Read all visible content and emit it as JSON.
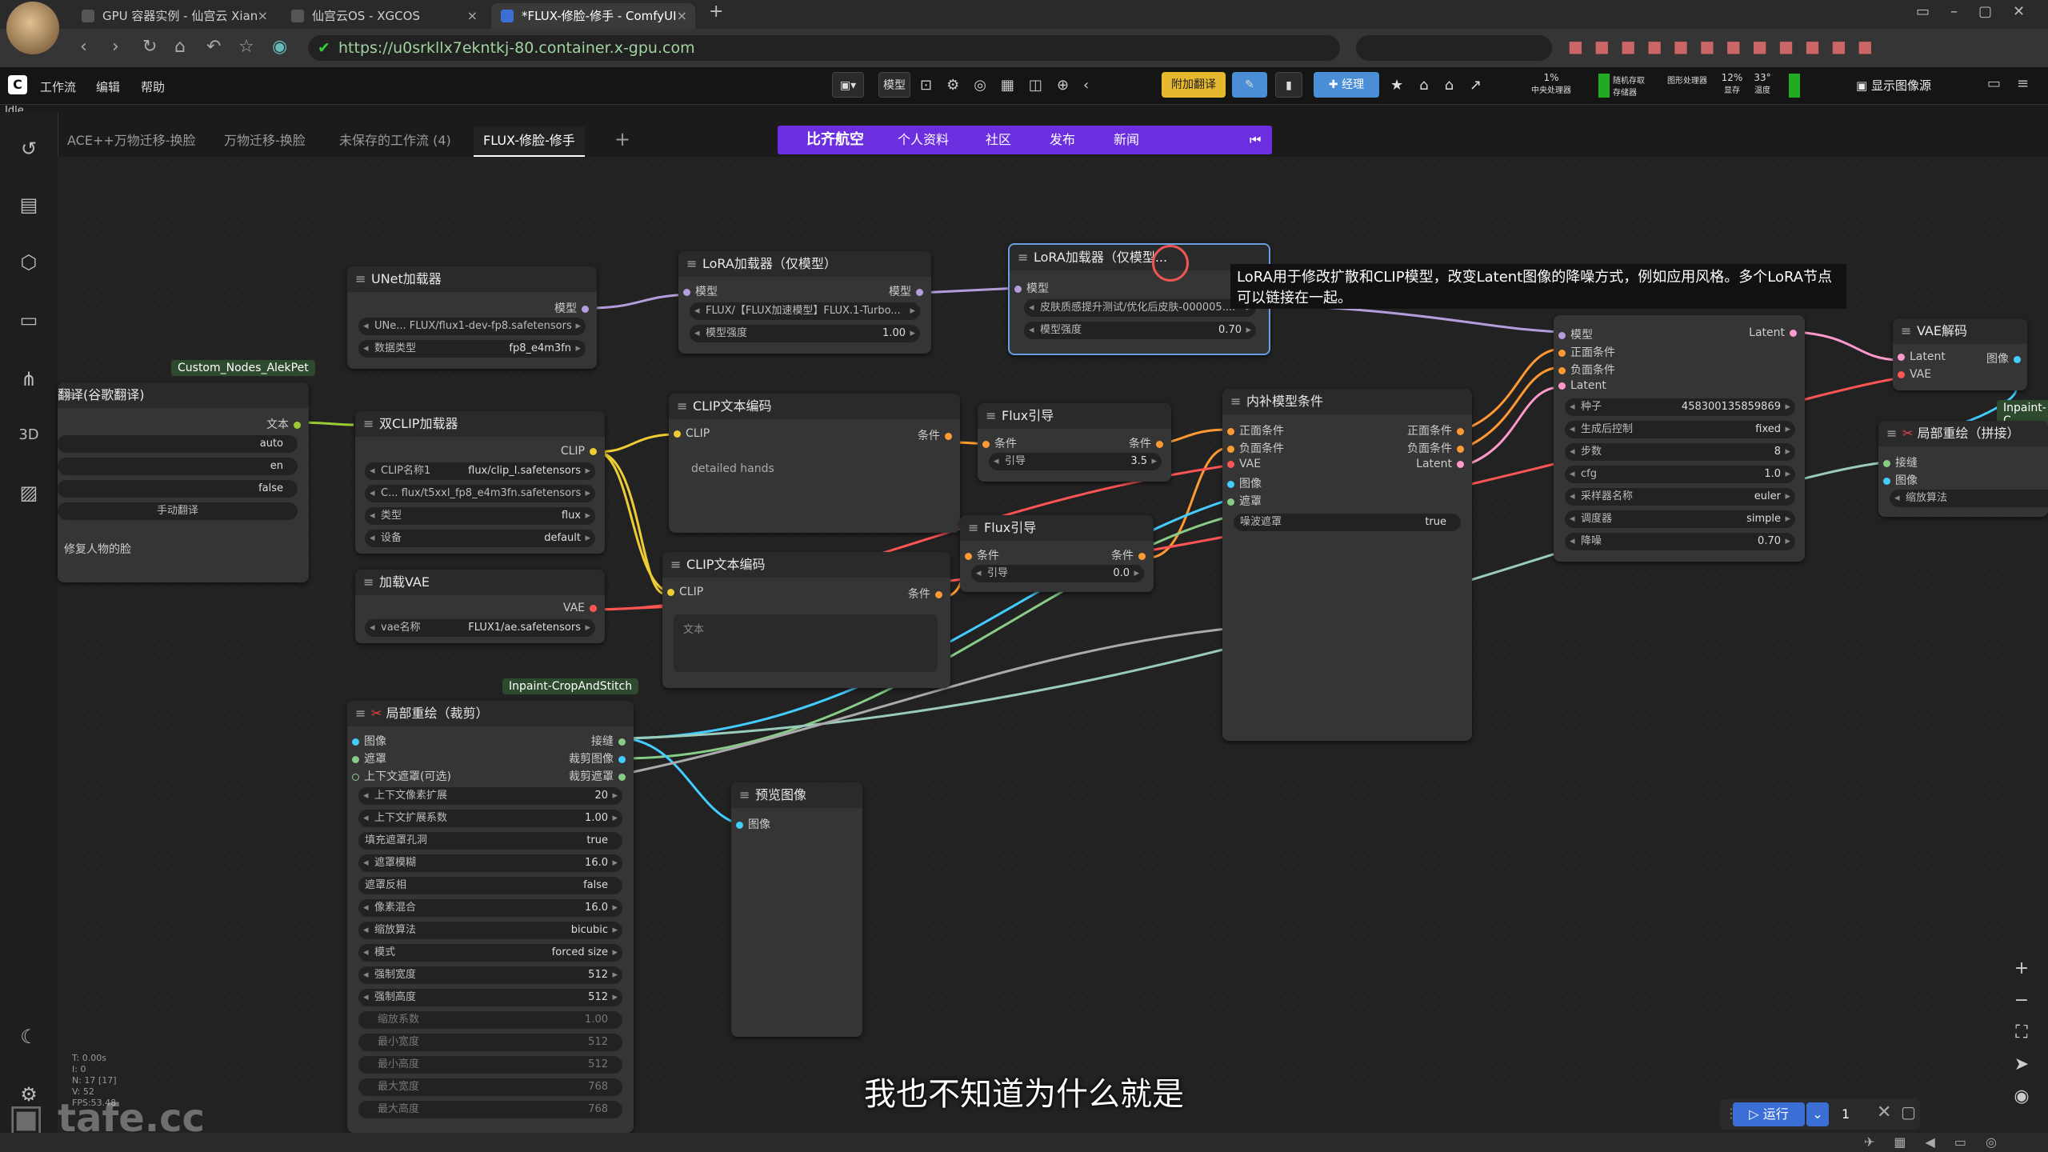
{
  "browser": {
    "tabs": [
      {
        "label": "GPU 容器实例 - 仙宫云 Xian"
      },
      {
        "label": "仙宫云OS - XGCOS"
      },
      {
        "label": "*FLUX-修脸-修手 - ComfyUI"
      }
    ],
    "url": "https://u0srkllx7ekntkj-80.container.x-gpu.com"
  },
  "menu": {
    "items": [
      "工作流",
      "编辑",
      "帮助"
    ],
    "status": "Idle",
    "model_btn": "模型",
    "translate_btn": "附加翻译",
    "manager_btn": "经理",
    "cpu": "1%",
    "cpu_label": "中央处理器",
    "mem_label": "随机存取存储器",
    "gpu_label": "图形处理器",
    "vram": "12%",
    "vram_label": "显存",
    "temp": "33°",
    "temp_label": "温度",
    "show_image": "显示图像源"
  },
  "workflow_tabs": [
    "ACE++万物迁移-换脸",
    "万物迁移-换脸",
    "未保存的工作流 (4)",
    "FLUX-修脸-修手"
  ],
  "banner": {
    "brand": "比齐航空",
    "items": [
      "个人资料",
      "社区",
      "发布",
      "新闻"
    ]
  },
  "nodes": {
    "unet": {
      "title": "UNet加载器",
      "out": "模型",
      "w1_label": "UNe... FLUX/flux1-dev-fp8.safetensors",
      "w2_label": "数据类型",
      "w2_value": "fp8_e4m3fn"
    },
    "lora1": {
      "title": "LoRA加载器（仅模型）",
      "in": "模型",
      "out": "模型",
      "w1": "FLUX/【FLUX加速模型】FLUX.1-Turbo...",
      "w2_label": "模型强度",
      "w2_value": "1.00"
    },
    "lora2": {
      "title": "LoRA加载器（仅模型...",
      "in": "模型",
      "w1": "皮肤质感提升测试/优化后皮肤-000005....",
      "w2_label": "模型强度",
      "w2_value": "0.70"
    },
    "translate": {
      "tag": "Custom_Nodes_AlekPet",
      "title": "翻译(谷歌翻译)",
      "out": "文本",
      "w1_value": "auto",
      "w2_value": "en",
      "w3_value": "false",
      "btn": "手动翻译",
      "text": "修复人物的脸"
    },
    "dualclip": {
      "title": "双CLIP加载器",
      "out": "CLIP",
      "w1_label": "CLIP名称1",
      "w1_value": "flux/clip_l.safetensors",
      "w2_label": "C... flux/t5xxl_fp8_e4m3fn.safetensors",
      "w3_label": "类型",
      "w3_value": "flux",
      "w4_label": "设备",
      "w4_value": "default"
    },
    "vae": {
      "title": "加载VAE",
      "out": "VAE",
      "w1_label": "vae名称",
      "w1_value": "FLUX1/ae.safetensors"
    },
    "clip1": {
      "title": "CLIP文本编码",
      "in": "CLIP",
      "out": "条件",
      "text": "detailed hands"
    },
    "clip2": {
      "title": "CLIP文本编码",
      "in": "CLIP",
      "out": "条件",
      "text": "文本"
    },
    "flux1": {
      "title": "Flux引导",
      "in": "条件",
      "out": "条件",
      "w_label": "引导",
      "w_value": "3.5"
    },
    "flux2": {
      "title": "Flux引导",
      "in": "条件",
      "out": "条件",
      "w_label": "引导",
      "w_value": "0.0"
    },
    "inpaint": {
      "title": "内补模型条件",
      "ins": [
        "正面条件",
        "负面条件",
        "VAE",
        "图像",
        "遮罩"
      ],
      "outs": [
        "正面条件",
        "负面条件",
        "Latent"
      ],
      "w_label": "噪波遮罩",
      "w_value": "true"
    },
    "ksampler": {
      "ins": [
        "模型",
        "正面条件",
        "负面条件",
        "Latent"
      ],
      "out": "Latent",
      "widgets": [
        [
          "种子",
          "458300135859869"
        ],
        [
          "生成后控制",
          "fixed"
        ],
        [
          "步数",
          "8"
        ],
        [
          "cfg",
          "1.0"
        ],
        [
          "采样器名称",
          "euler"
        ],
        [
          "调度器",
          "simple"
        ],
        [
          "降噪",
          "0.70"
        ]
      ]
    },
    "vaedecode": {
      "title": "VAE解码",
      "ins": [
        "Latent",
        "VAE"
      ],
      "out": "图像"
    },
    "stitch": {
      "tag": "Inpaint-C",
      "title": "局部重绘（拼接）",
      "ins": [
        "接缝",
        "图像"
      ],
      "w_label": "缩放算法"
    },
    "crop": {
      "tag": "Inpaint-CropAndStitch",
      "title": "局部重绘（裁剪）",
      "ins": [
        "图像",
        "遮罩",
        "上下文遮罩(可选)"
      ],
      "outs": [
        "接缝",
        "裁剪图像",
        "裁剪遮罩"
      ],
      "widgets": [
        [
          "上下文像素扩展",
          "20"
        ],
        [
          "上下文扩展系数",
          "1.00"
        ],
        [
          "填充遮罩孔洞",
          "true"
        ],
        [
          "遮罩模糊",
          "16.0"
        ],
        [
          "遮罩反相",
          "false"
        ],
        [
          "像素混合",
          "16.0"
        ],
        [
          "缩放算法",
          "bicubic"
        ],
        [
          "模式",
          "forced size"
        ],
        [
          "强制宽度",
          "512"
        ],
        [
          "强制高度",
          "512"
        ],
        [
          "缩放系数",
          "1.00"
        ],
        [
          "最小宽度",
          "512"
        ],
        [
          "最小高度",
          "512"
        ],
        [
          "最大宽度",
          "768"
        ],
        [
          "最大高度",
          "768"
        ]
      ]
    },
    "preview": {
      "title": "预览图像",
      "in": "图像"
    }
  },
  "tooltip": "LoRA用于修改扩散和CLIP模型，改变Latent图像的降噪方式，例如应用风格。多个LoRA节点可以链接在一起。",
  "subtitle": "我也不知道为什么就是",
  "run": {
    "label": "运行",
    "count": "1"
  },
  "watermark": "tafe.cc",
  "stats": [
    "T: 0.00s",
    "I: 0",
    "N: 17 [17]",
    "V: 52",
    "FPS:53.48"
  ]
}
